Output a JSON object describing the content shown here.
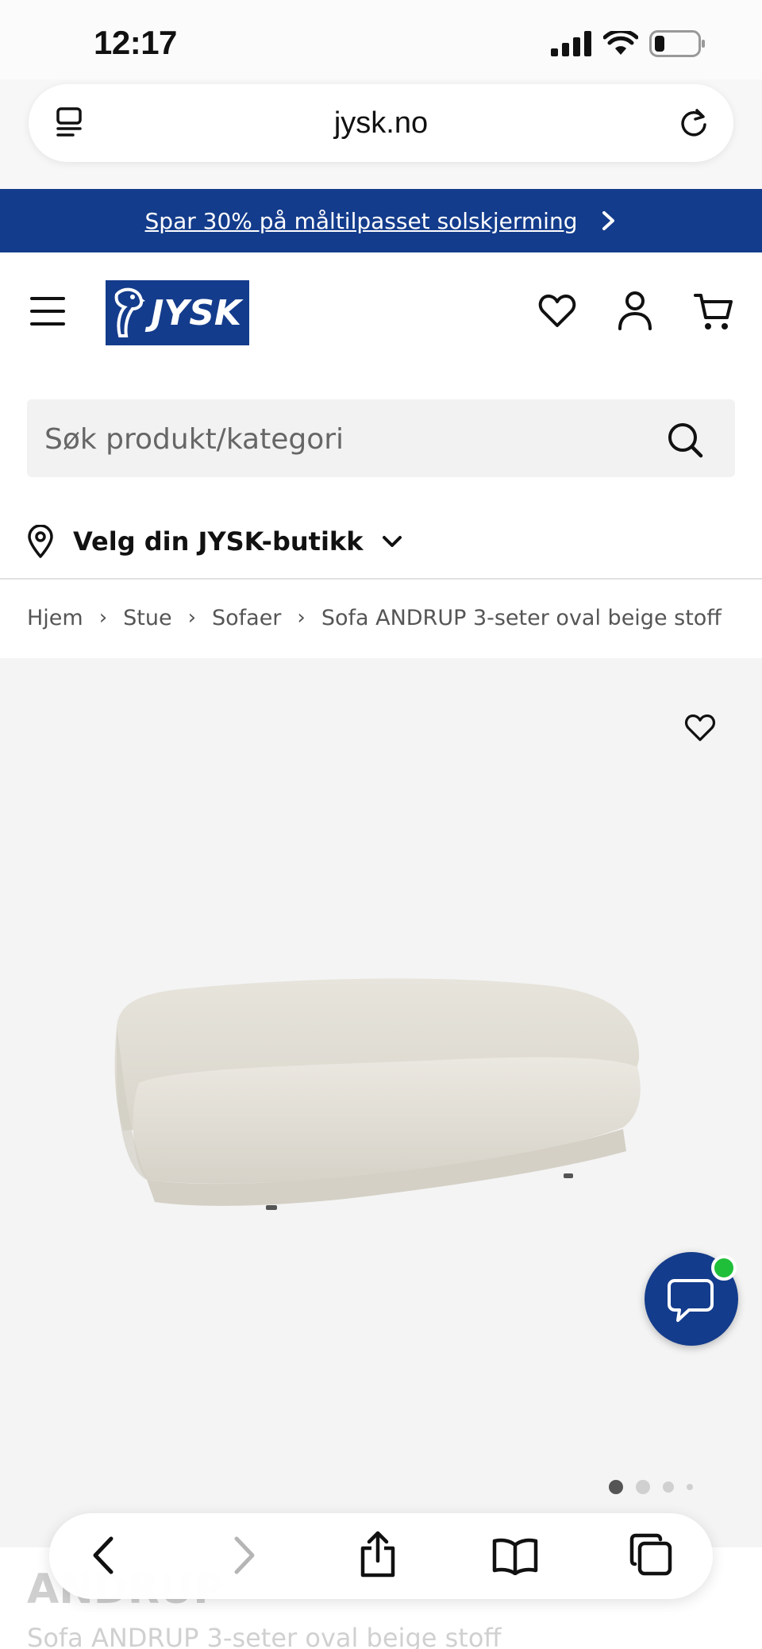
{
  "status_bar": {
    "time": "12:17",
    "icons": [
      "signal-icon",
      "wifi-icon",
      "battery-icon"
    ]
  },
  "browser": {
    "url": "jysk.no",
    "toolbar_icons": [
      "back-icon",
      "forward-icon",
      "share-icon",
      "bookmarks-icon",
      "tabs-icon"
    ]
  },
  "promo": {
    "text": "Spar 30% på måltilpasset solskjerming"
  },
  "header": {
    "logo_text": "JYSK",
    "icons": [
      "menu-icon",
      "heart-icon",
      "account-icon",
      "cart-icon"
    ]
  },
  "search": {
    "placeholder": "Søk produkt/kategori"
  },
  "store": {
    "label": "Velg din JYSK-butikk"
  },
  "breadcrumb": {
    "items": [
      "Hjem",
      "Stue",
      "Sofaer",
      "Sofa ANDRUP 3-seter oval beige stoff"
    ]
  },
  "product": {
    "name": "ANDRUP",
    "subtitle": "Sofa ANDRUP 3-seter oval beige stoff",
    "image_count": 4,
    "active_image": 1
  },
  "colors": {
    "brand_blue": "#143c8c",
    "chat_online": "#1fbf3a",
    "gallery_bg": "#f4f4f4"
  }
}
